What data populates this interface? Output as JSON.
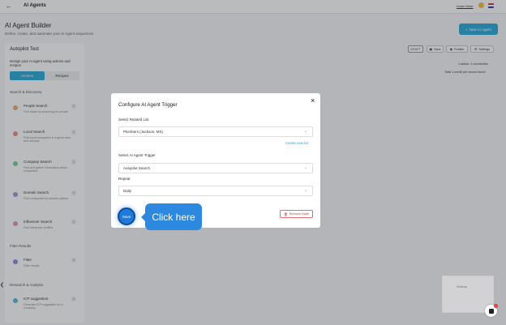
{
  "header": {
    "title": "AI Agents",
    "learn_more": "Learn More"
  },
  "page": {
    "title": "AI Agent Builder",
    "subtitle": "Define, create, and automate your AI Agent sequences",
    "new_agent_label": "New AI Agent"
  },
  "sidebar": {
    "agent_name": "Autopilot Test",
    "design_text": "Design your AI agent using actions and recipes",
    "tabs": [
      "Actions",
      "Recipes"
    ],
    "sections": {
      "search": "Search & Discovery",
      "filter": "Filter Results",
      "research": "Research & Analysis"
    },
    "items": [
      {
        "name": "People Search",
        "desc": "Find leads by searching for people",
        "count": "1",
        "color": "#e8935a"
      },
      {
        "name": "Local Search",
        "desc": "Find local companies in a given area and industry",
        "count": "1",
        "color": "#e07070"
      },
      {
        "name": "Company Search",
        "desc": "Find and gather information about companies",
        "count": "1",
        "color": "#5fbf7a"
      },
      {
        "name": "Domain Search",
        "desc": "Find companies by domain pattern",
        "count": "1",
        "color": "#8a76d6"
      },
      {
        "name": "Influencer Search",
        "desc": "Find influencer profiles",
        "count": "1",
        "color": "#d676c0"
      },
      {
        "name": "Filter",
        "desc": "Filter results",
        "count": "0",
        "color": "#6b6be0"
      },
      {
        "name": "ICP suggestion",
        "desc": "Generate ICP suggestion for a company",
        "count": "0",
        "color": "#29a8d9"
      }
    ]
  },
  "toolbar": {
    "status": "DRAFT",
    "save": "Save",
    "publish": "Publish",
    "settings": "Settings",
    "stats_line1": "1 action, 0 connection",
    "stats_line2": "Total 1 credit per record found"
  },
  "canvas": {
    "minimap_label": "Minimap",
    "chat_badge": "1"
  },
  "modal": {
    "title": "Configure AI Agent Trigger",
    "related_list_label": "Select Related List",
    "related_list_value": "Plumbers (Jackson, MS)",
    "create_new_list": "Create new list",
    "trigger_label": "Select AI Agent Trigger",
    "trigger_value": "Autopilot Search",
    "repeat_label": "Repeat",
    "repeat_value": "Daily",
    "save": "Save",
    "remove_node": "Remove Node"
  },
  "tooltip": {
    "text": "Click here"
  },
  "colors": {
    "accent": "#29a8d9",
    "danger": "#d33333",
    "tooltip": "#2d88e0"
  }
}
